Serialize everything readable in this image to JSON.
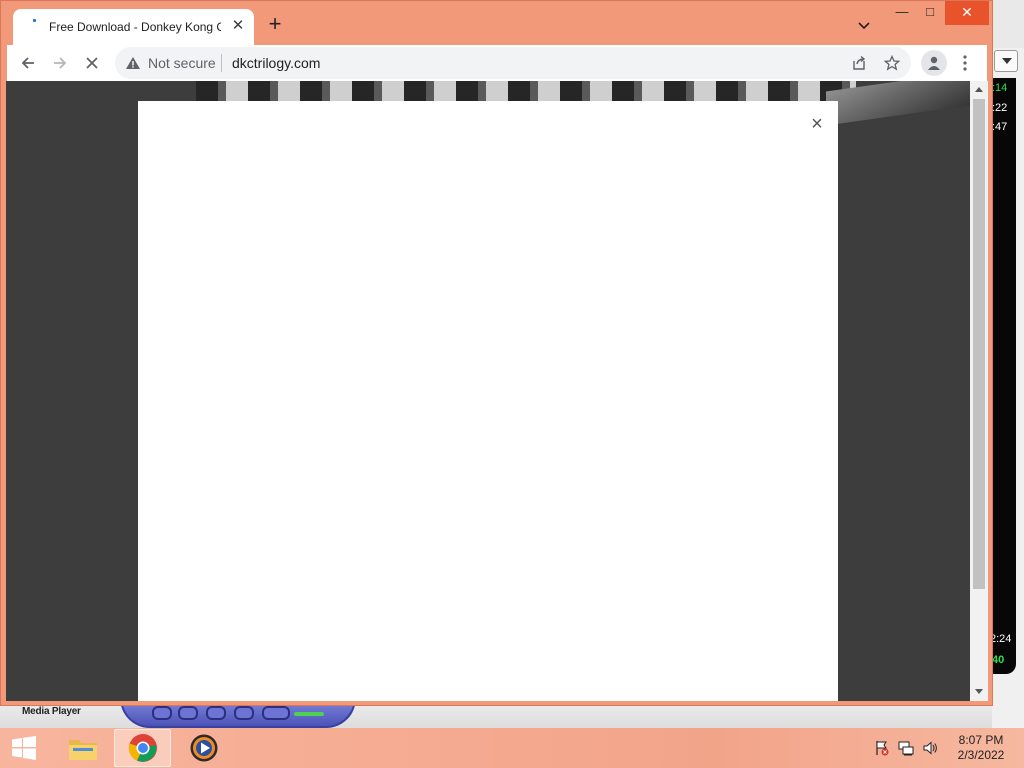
{
  "browser": {
    "tab": {
      "title": "Free Download - Donkey Kong C",
      "close_icon": "close-icon"
    },
    "new_tab_icon": "plus-icon",
    "tab_search_icon": "chevron-down-icon",
    "window_controls": {
      "minimize": "—",
      "maximize": "□",
      "close": "✕"
    },
    "toolbar": {
      "back_icon": "arrow-left-icon",
      "forward_icon": "arrow-right-icon",
      "stop_icon": "close-icon",
      "security_label": "Not secure",
      "url": "dkctrilogy.com",
      "share_icon": "share-icon",
      "bookmark_icon": "star-icon",
      "profile_icon": "profile-icon",
      "menu_icon": "more-vert-icon"
    },
    "modal": {
      "close_label": "×"
    },
    "accent": "#f2997a"
  },
  "background": {
    "media_player_label": "Media Player",
    "side_times": [
      ":14",
      ":22",
      ":47",
      "2:24",
      "40"
    ]
  },
  "taskbar": {
    "apps": [
      "file-explorer-icon",
      "chrome-icon",
      "windows-media-player-icon"
    ],
    "tray_icons": [
      "action-center-flag-icon",
      "network-icon",
      "volume-icon"
    ],
    "time": "8:07 PM",
    "date": "2/3/2022"
  }
}
